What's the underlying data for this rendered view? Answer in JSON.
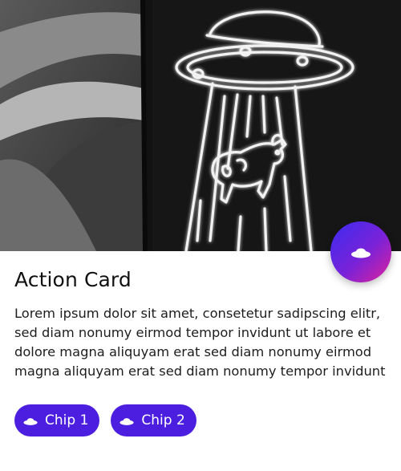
{
  "card": {
    "title": "Action Card",
    "body": "Lorem ipsum dolor sit amet, consetetur sadipscing elitr, sed diam nonumy eirmod tempor invidunt ut labore et dolore magna aliquyam erat sed diam nonumy eirmod magna aliquyam erat sed diam nonumy tempor invidunt",
    "media_description": "neon UFO abducting cow",
    "fab_icon": "ufo-icon",
    "chips": [
      {
        "label": "Chip 1",
        "icon": "ufo-icon"
      },
      {
        "label": "Chip 2",
        "icon": "ufo-icon"
      }
    ]
  },
  "colors": {
    "chip_background": "#4c1fe0",
    "fab_gradient_start": "#3a2cf0",
    "fab_gradient_end": "#e0239a",
    "title_text": "#111111"
  }
}
